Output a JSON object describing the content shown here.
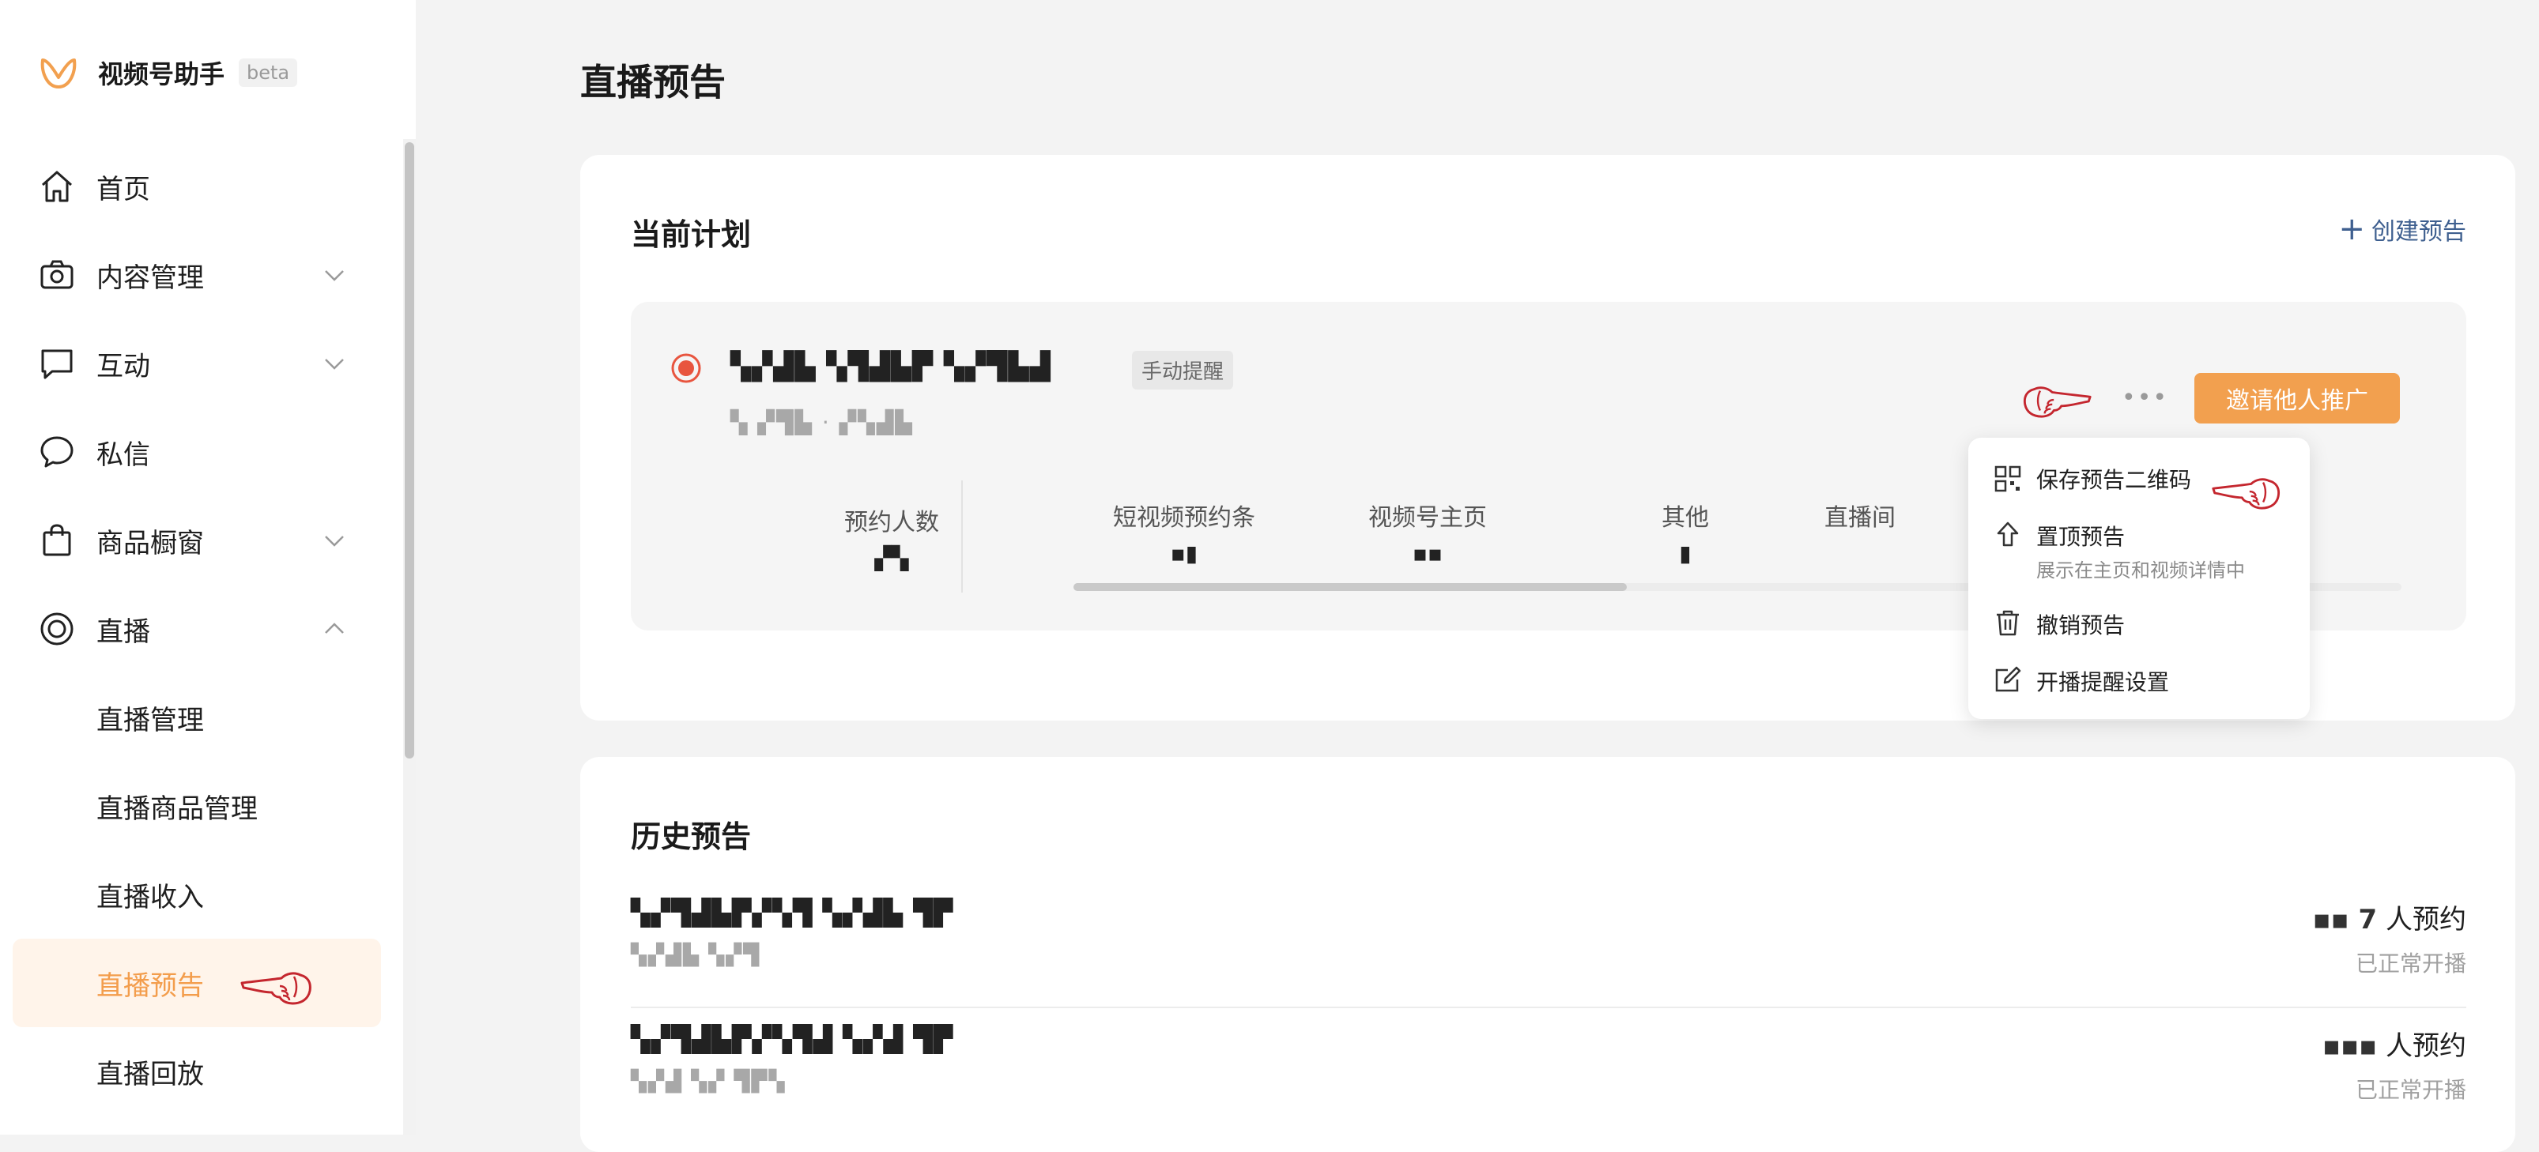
{
  "brand": {
    "name": "视频号助手",
    "badge": "beta"
  },
  "sidebar": {
    "items": [
      {
        "label": "首页",
        "icon": "home-icon"
      },
      {
        "label": "内容管理",
        "icon": "camera-icon",
        "expandable": true
      },
      {
        "label": "互动",
        "icon": "comment-icon",
        "expandable": true
      },
      {
        "label": "私信",
        "icon": "chat-bubble-icon"
      },
      {
        "label": "商品橱窗",
        "icon": "shopping-bag-icon",
        "expandable": true
      },
      {
        "label": "直播",
        "icon": "live-icon",
        "expandable": true,
        "expanded": true
      }
    ],
    "live_sub_items": [
      {
        "label": "直播管理"
      },
      {
        "label": "直播商品管理"
      },
      {
        "label": "直播收入"
      },
      {
        "label": "直播预告",
        "active": true
      },
      {
        "label": "直播回放"
      }
    ]
  },
  "page": {
    "title": "直播预告"
  },
  "current_plan": {
    "section_title": "当前计划",
    "create_label": "创建预告",
    "plan": {
      "title": "▚▞▟▙ ▚▜▟▙▛ ▚▞▜▙▟",
      "tag": "手动提醒",
      "subtitle": "▚ ▞▜▙ · ▞▚▟▙",
      "invite_button": "邀请他人推广",
      "stats": [
        {
          "label": "预约人数",
          "value": "▞▚"
        },
        {
          "label": "短视频预约条",
          "value": "▪▮"
        },
        {
          "label": "视频号主页",
          "value": "▪▪"
        },
        {
          "label": "其他",
          "value": "▮"
        },
        {
          "label": "直播间",
          "value": ""
        }
      ]
    },
    "menu": {
      "items": [
        {
          "label": "保存预告二维码",
          "icon": "qrcode-icon"
        },
        {
          "label": "置顶预告",
          "desc": "展示在主页和视频详情中",
          "icon": "pin-top-icon"
        },
        {
          "label": "撤销预告",
          "icon": "trash-icon"
        },
        {
          "label": "开播提醒设置",
          "icon": "edit-icon"
        }
      ]
    }
  },
  "history": {
    "section_title": "历史预告",
    "rows": [
      {
        "title": "▚▞▜▟▙▛▞▚▜ ▚▞▟▙ ▜▛",
        "subtitle": "▚▞▟▙ ▚▞▜",
        "count": "▪▪ 7",
        "count_suffix": "人预约",
        "status": "已正常开播"
      },
      {
        "title": "▚▞▜▟▙▛▞▚▜▟ ▚▞▟ ▜▛",
        "subtitle": "▚▞▟ ▚▞ ▜▛▚",
        "count": "▪▪▪",
        "count_suffix": "人预约",
        "status": "已正常开播"
      }
    ]
  },
  "colors": {
    "accent": "#f2a04f",
    "link": "#3e5f8f",
    "live_red": "#e8553f",
    "hand_red": "#c4262e"
  }
}
